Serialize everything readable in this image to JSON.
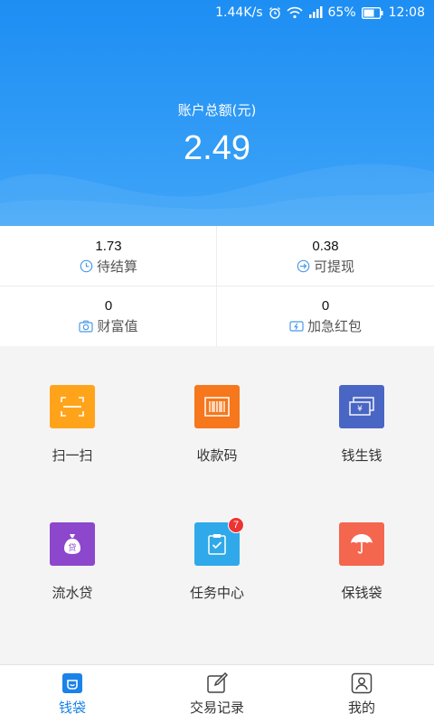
{
  "status_bar": {
    "speed": "1.44K/s",
    "battery": "65%",
    "time": "12:08"
  },
  "header": {
    "balance_label": "账户总额(元)",
    "balance_value": "2.49"
  },
  "stats": [
    {
      "value": "1.73",
      "label": "待结算",
      "icon": "clock-icon"
    },
    {
      "value": "0.38",
      "label": "可提现",
      "icon": "arrow-right-circle-icon"
    },
    {
      "value": "0",
      "label": "财富值",
      "icon": "camera-icon"
    },
    {
      "value": "0",
      "label": "加急红包",
      "icon": "lightning-card-icon"
    }
  ],
  "grid": [
    {
      "label": "扫一扫",
      "icon": "scan-icon",
      "color": "#ffa41a"
    },
    {
      "label": "收款码",
      "icon": "barcode-icon",
      "color": "#f6771c"
    },
    {
      "label": "钱生钱",
      "icon": "money-bill-icon",
      "color": "#4a66c4"
    },
    {
      "label": "流水贷",
      "icon": "money-bag-icon",
      "color": "#8c47cc"
    },
    {
      "label": "任务中心",
      "icon": "clipboard-check-icon",
      "color": "#2fa9ea",
      "badge": "7"
    },
    {
      "label": "保钱袋",
      "icon": "umbrella-icon",
      "color": "#f4664e"
    }
  ],
  "tabs": [
    {
      "label": "钱袋",
      "icon": "wallet-icon",
      "active": true
    },
    {
      "label": "交易记录",
      "icon": "edit-icon",
      "active": false
    },
    {
      "label": "我的",
      "icon": "user-icon",
      "active": false
    }
  ],
  "colors": {
    "primary": "#1d8ef3",
    "tab_active": "#1a82e8"
  }
}
